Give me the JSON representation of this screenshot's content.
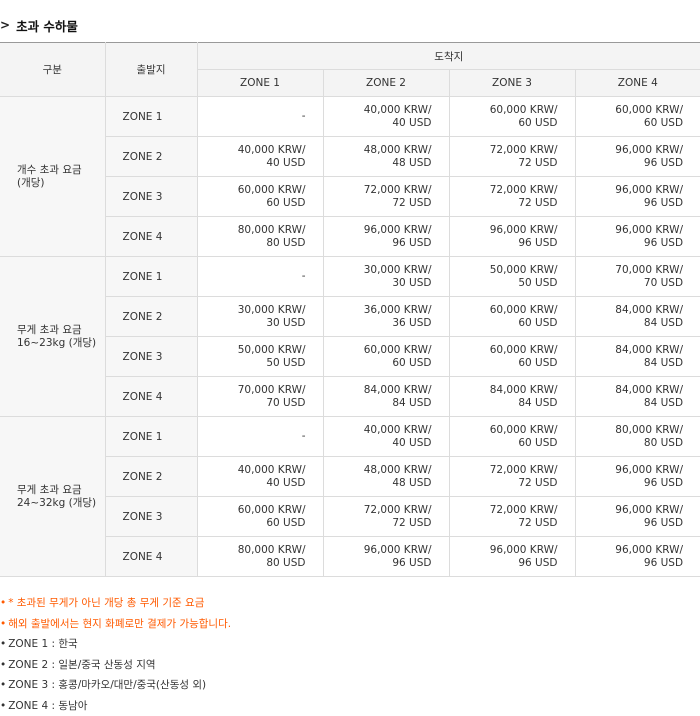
{
  "title": "초과 수하물",
  "table": {
    "header_group": "구분",
    "header_departure": "출발지",
    "header_arrival": "도착지",
    "arrival_zones": [
      "ZONE 1",
      "ZONE 2",
      "ZONE 3",
      "ZONE 4"
    ],
    "groups": [
      {
        "label": [
          "개수 초과 요금",
          "(개당)"
        ],
        "rows": [
          {
            "departure": "ZONE 1",
            "values": [
              [
                "-"
              ],
              [
                "40,000 KRW/",
                "40 USD"
              ],
              [
                "60,000 KRW/",
                "60 USD"
              ],
              [
                "60,000 KRW/",
                "60 USD"
              ]
            ]
          },
          {
            "departure": "ZONE 2",
            "values": [
              [
                "40,000 KRW/",
                "40 USD"
              ],
              [
                "48,000 KRW/",
                "48 USD"
              ],
              [
                "72,000 KRW/",
                "72 USD"
              ],
              [
                "96,000 KRW/",
                "96 USD"
              ]
            ]
          },
          {
            "departure": "ZONE 3",
            "values": [
              [
                "60,000 KRW/",
                "60 USD"
              ],
              [
                "72,000 KRW/",
                "72 USD"
              ],
              [
                "72,000 KRW/",
                "72 USD"
              ],
              [
                "96,000 KRW/",
                "96 USD"
              ]
            ]
          },
          {
            "departure": "ZONE 4",
            "values": [
              [
                "80,000 KRW/",
                "80 USD"
              ],
              [
                "96,000 KRW/",
                "96 USD"
              ],
              [
                "96,000 KRW/",
                "96 USD"
              ],
              [
                "96,000 KRW/",
                "96 USD"
              ]
            ]
          }
        ]
      },
      {
        "label": [
          "무게 초과 요금",
          "16~23kg (개당)"
        ],
        "rows": [
          {
            "departure": "ZONE 1",
            "values": [
              [
                "-"
              ],
              [
                "30,000 KRW/",
                "30 USD"
              ],
              [
                "50,000 KRW/",
                "50 USD"
              ],
              [
                "70,000 KRW/",
                "70 USD"
              ]
            ]
          },
          {
            "departure": "ZONE 2",
            "values": [
              [
                "30,000 KRW/",
                "30 USD"
              ],
              [
                "36,000 KRW/",
                "36 USD"
              ],
              [
                "60,000 KRW/",
                "60 USD"
              ],
              [
                "84,000 KRW/",
                "84 USD"
              ]
            ]
          },
          {
            "departure": "ZONE 3",
            "values": [
              [
                "50,000 KRW/",
                "50 USD"
              ],
              [
                "60,000 KRW/",
                "60 USD"
              ],
              [
                "60,000 KRW/",
                "60 USD"
              ],
              [
                "84,000 KRW/",
                "84 USD"
              ]
            ]
          },
          {
            "departure": "ZONE 4",
            "values": [
              [
                "70,000 KRW/",
                "70 USD"
              ],
              [
                "84,000 KRW/",
                "84 USD"
              ],
              [
                "84,000 KRW/",
                "84 USD"
              ],
              [
                "84,000 KRW/",
                "84 USD"
              ]
            ]
          }
        ]
      },
      {
        "label": [
          "무게 초과 요금",
          "24~32kg (개당)"
        ],
        "rows": [
          {
            "departure": "ZONE 1",
            "values": [
              [
                "-"
              ],
              [
                "40,000 KRW/",
                "40 USD"
              ],
              [
                "60,000 KRW/",
                "60 USD"
              ],
              [
                "80,000 KRW/",
                "80 USD"
              ]
            ]
          },
          {
            "departure": "ZONE 2",
            "values": [
              [
                "40,000 KRW/",
                "40 USD"
              ],
              [
                "48,000 KRW/",
                "48 USD"
              ],
              [
                "72,000 KRW/",
                "72 USD"
              ],
              [
                "96,000 KRW/",
                "96 USD"
              ]
            ]
          },
          {
            "departure": "ZONE 3",
            "values": [
              [
                "60,000 KRW/",
                "60 USD"
              ],
              [
                "72,000 KRW/",
                "72 USD"
              ],
              [
                "72,000 KRW/",
                "72 USD"
              ],
              [
                "96,000 KRW/",
                "96 USD"
              ]
            ]
          },
          {
            "departure": "ZONE 4",
            "values": [
              [
                "80,000 KRW/",
                "80 USD"
              ],
              [
                "96,000 KRW/",
                "96 USD"
              ],
              [
                "96,000 KRW/",
                "96 USD"
              ],
              [
                "96,000 KRW/",
                "96 USD"
              ]
            ]
          }
        ]
      }
    ]
  },
  "notes": [
    {
      "text": "* 초과된 무게가 아닌 개당 총 무게 기준 요금",
      "style": "orange"
    },
    {
      "text": "해외 출발에서는 현지 화폐로만 결제가 가능합니다.",
      "style": "orange"
    },
    {
      "text": "ZONE 1 : 한국",
      "style": "dark"
    },
    {
      "text": "ZONE 2 : 일본/중국 산동성 지역",
      "style": "dark"
    },
    {
      "text": "ZONE 3 : 홍콩/마카오/대만/중국(산동성 외)",
      "style": "dark"
    },
    {
      "text": "ZONE 4 : 동남아",
      "style": "dark"
    }
  ],
  "colors": {
    "note_accent": "#ff5a00",
    "header_bg": "#f4f4f4",
    "label_bg": "#f7f7f7",
    "border": "#dcdcdc"
  },
  "icons": {
    "title_marker": "chevron-right-icon",
    "note_bullet": "bullet-dot-icon"
  }
}
